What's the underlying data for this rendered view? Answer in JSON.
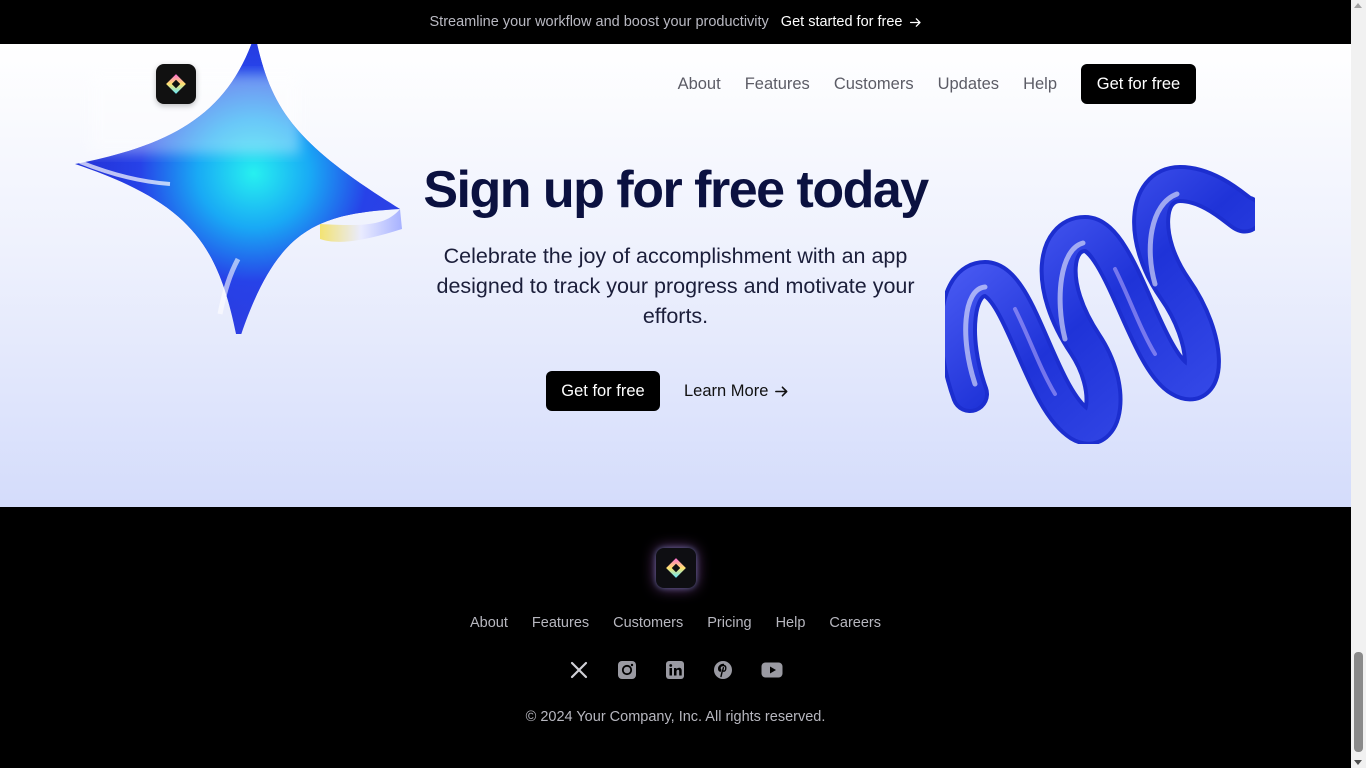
{
  "announcement": {
    "message": "Streamline your workflow and boost your productivity",
    "cta_label": "Get started for free",
    "cta_icon": "arrow-right-icon"
  },
  "nav": {
    "logo_icon": "diamond-logo-icon",
    "links": [
      "About",
      "Features",
      "Customers",
      "Updates",
      "Help"
    ],
    "cta_label": "Get for free"
  },
  "hero": {
    "headline": "Sign up for free today",
    "subtext": "Celebrate the joy of accomplishment with an app designed to track your progress and motivate your efforts.",
    "primary_label": "Get for free",
    "secondary_label": "Learn More",
    "secondary_icon": "arrow-right-icon",
    "decorations": [
      "star-3d-shape",
      "spring-3d-shape"
    ]
  },
  "footer": {
    "logo_icon": "diamond-logo-icon",
    "links": [
      "About",
      "Features",
      "Customers",
      "Pricing",
      "Help",
      "Careers"
    ],
    "socials": [
      "x-icon",
      "instagram-icon",
      "linkedin-icon",
      "pinterest-icon",
      "youtube-icon"
    ],
    "copyright": "© 2024 Your Company, Inc. All rights reserved."
  },
  "colors": {
    "headline": "#0b1140",
    "button": "#000000",
    "hero_bottom": "#d4dcfb",
    "footer_bg": "#000000"
  }
}
